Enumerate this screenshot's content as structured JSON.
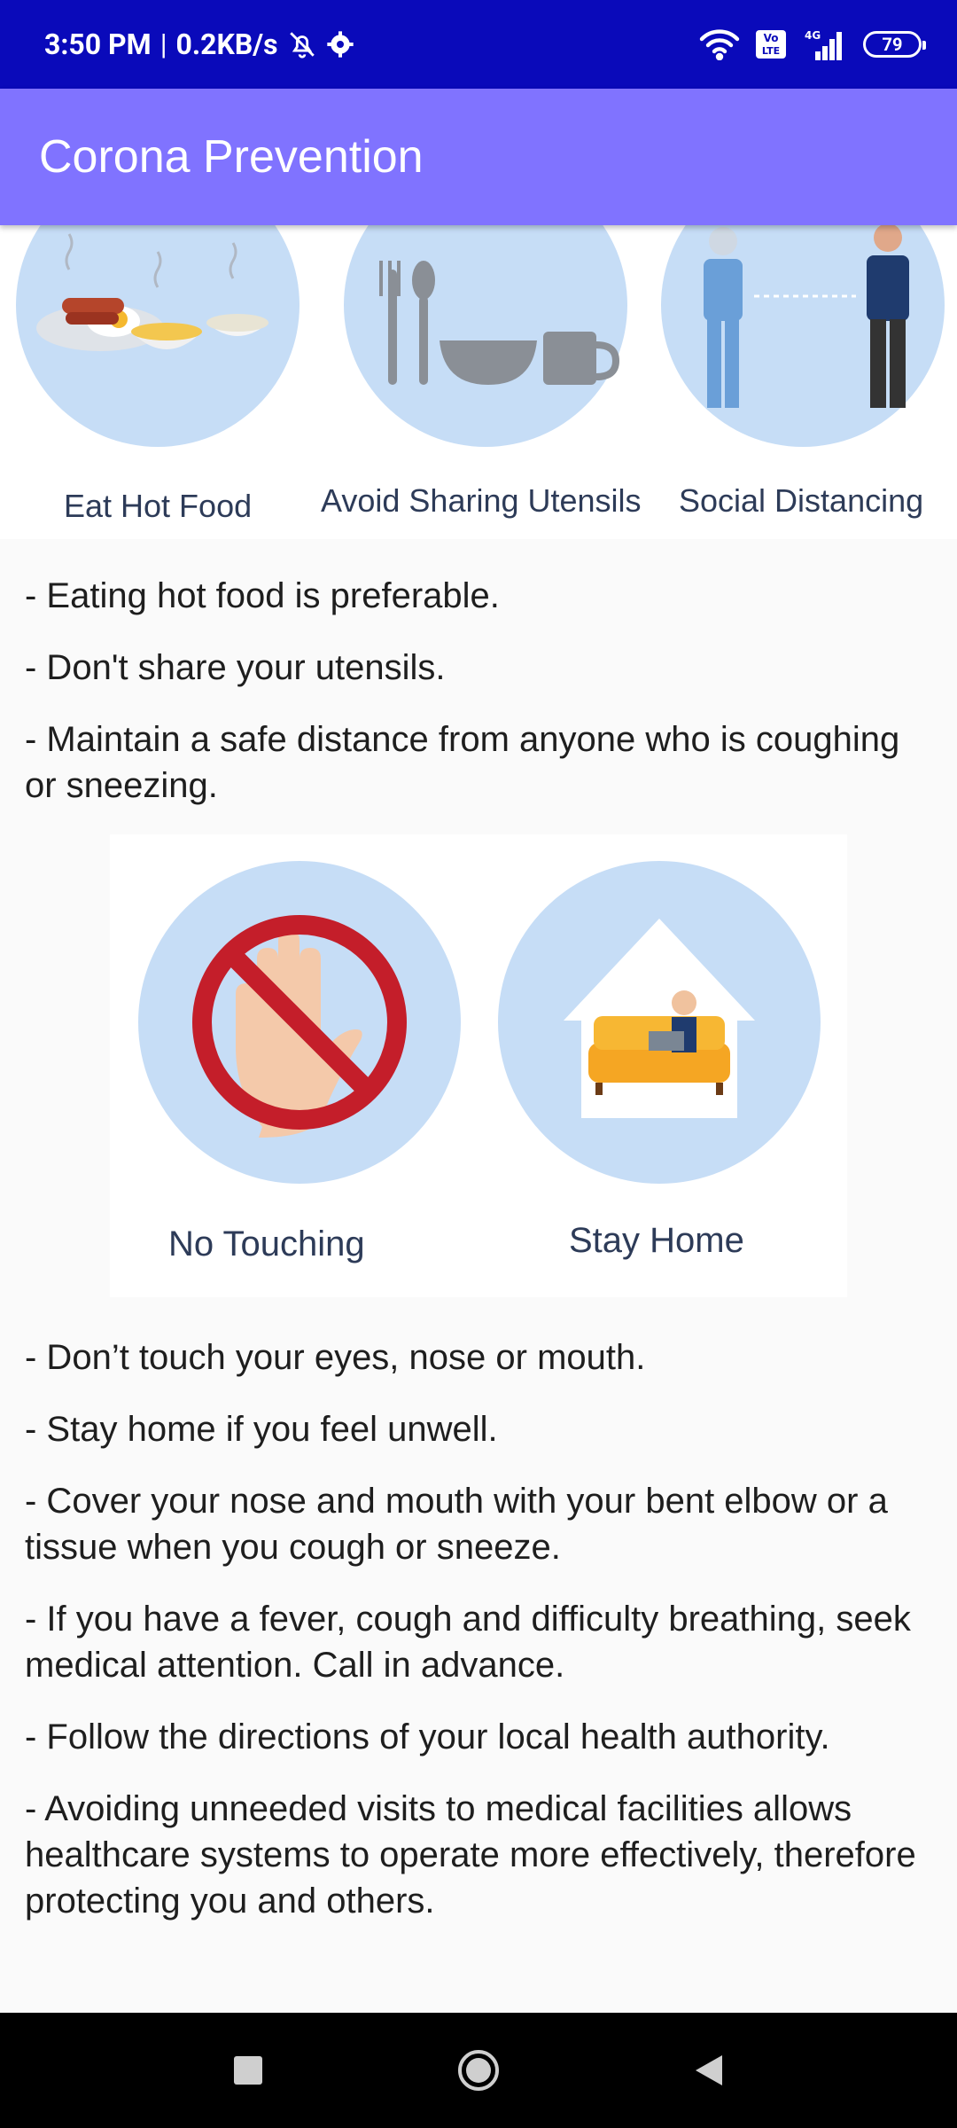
{
  "status_bar": {
    "time": "3:50 PM",
    "separator": "|",
    "network_speed": "0.2KB/s",
    "battery": "79",
    "signal_label": "4G",
    "volte_label": "Vo LTE",
    "icons": [
      "bell-off-icon",
      "gear-icon",
      "wifi-icon",
      "volte-icon",
      "signal-icon",
      "battery-icon"
    ]
  },
  "app_bar": {
    "title": "Corona Prevention",
    "color": "#8073ff"
  },
  "banner_top": {
    "labels": [
      "Eat Hot Food",
      "Avoid Sharing Utensils",
      "Social Distancing"
    ]
  },
  "tips_group_1": [
    "- Eating hot food is preferable.",
    "- Don't share your utensils.",
    "- Maintain a safe distance from anyone who is coughing or sneezing."
  ],
  "banner_mid": {
    "labels": [
      "No Touching",
      "Stay Home"
    ]
  },
  "tips_group_2": [
    "- Don’t touch your eyes, nose or mouth.",
    "- Stay home if you feel unwell.",
    "- Cover your nose and mouth with your bent elbow or a tissue when you cough or sneeze.",
    "- If you have a fever, cough and difficulty breathing, seek medical attention. Call in advance.",
    "- Follow the directions of your local health authority.",
    "- Avoiding unneeded visits to medical facilities allows healthcare systems to operate more effectively, therefore protecting you and others."
  ],
  "nav_bar": {
    "icons": [
      "recents-square-icon",
      "home-circle-icon",
      "back-triangle-icon"
    ]
  },
  "colors": {
    "status_bar": "#0a0aba",
    "app_bar": "#8073ff",
    "circle": "#c6ddf6",
    "label_text": "#2d3b58"
  }
}
